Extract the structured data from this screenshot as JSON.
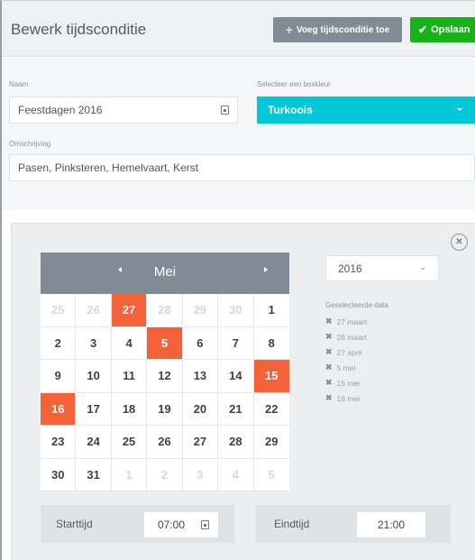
{
  "header": {
    "title": "Bewerk tijdsconditie",
    "add_label": "Voeg tijdsconditie toe",
    "save_label": "Opslaan"
  },
  "form": {
    "name_label": "Naam",
    "name_value": "Feestdagen 2016",
    "color_label": "Selecteer een boxkleur",
    "color_value": "Turkoois",
    "description_label": "Omschrijving",
    "description_value": "Pasen, Pinksteren, Hemelvaart, Kerst"
  },
  "calendar": {
    "month": "Mei",
    "year": "2016",
    "weeks": [
      [
        {
          "d": "25",
          "m": true
        },
        {
          "d": "26",
          "m": true
        },
        {
          "d": "27",
          "s": true
        },
        {
          "d": "28",
          "m": true
        },
        {
          "d": "29",
          "m": true
        },
        {
          "d": "30",
          "m": true
        },
        {
          "d": "1"
        }
      ],
      [
        {
          "d": "2"
        },
        {
          "d": "3"
        },
        {
          "d": "4"
        },
        {
          "d": "5",
          "s": true
        },
        {
          "d": "6"
        },
        {
          "d": "7"
        },
        {
          "d": "8"
        }
      ],
      [
        {
          "d": "9"
        },
        {
          "d": "10"
        },
        {
          "d": "11"
        },
        {
          "d": "12"
        },
        {
          "d": "13"
        },
        {
          "d": "14"
        },
        {
          "d": "15",
          "s": true
        }
      ],
      [
        {
          "d": "16",
          "s": true
        },
        {
          "d": "17"
        },
        {
          "d": "18"
        },
        {
          "d": "19"
        },
        {
          "d": "20"
        },
        {
          "d": "21"
        },
        {
          "d": "22"
        }
      ],
      [
        {
          "d": "23"
        },
        {
          "d": "24"
        },
        {
          "d": "25"
        },
        {
          "d": "26"
        },
        {
          "d": "27"
        },
        {
          "d": "28"
        },
        {
          "d": "29"
        }
      ],
      [
        {
          "d": "30"
        },
        {
          "d": "31"
        },
        {
          "d": "1",
          "m": true
        },
        {
          "d": "2",
          "m": true
        },
        {
          "d": "3",
          "m": true
        },
        {
          "d": "4",
          "m": true
        },
        {
          "d": "5",
          "m": true
        }
      ]
    ],
    "selected_title": "Geselecteerde data",
    "selected_dates": [
      "27 maart",
      "28 maart",
      "27 april",
      "5 mei",
      "15 mei",
      "16 mei"
    ]
  },
  "time": {
    "start_label": "Starttijd",
    "start_value": "07:00",
    "end_label": "Eindtijd",
    "end_value": "21:00"
  },
  "colors": {
    "accent_selected": "#f4623a",
    "box_color": "#00c8d7",
    "save_green": "#18b318"
  }
}
